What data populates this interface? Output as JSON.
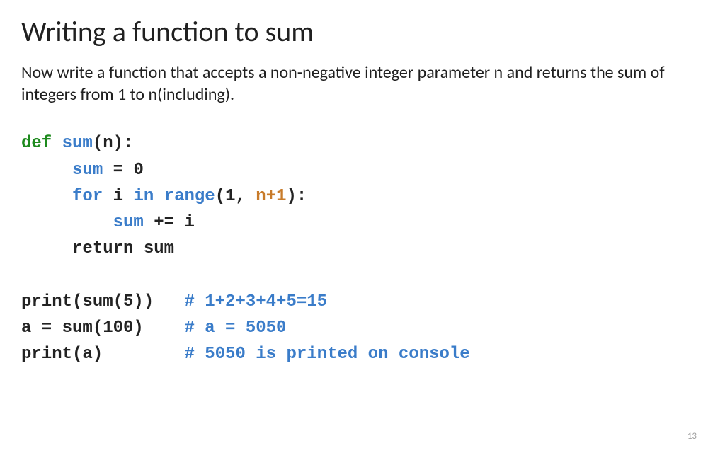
{
  "title": "Writing a function to sum",
  "description": "Now write a function that accepts a non-negative integer parameter n and returns the sum of integers from 1 to n(including).",
  "code": {
    "kw_def": "def",
    "fn_name": "sum",
    "paren_open_n": "(n):",
    "line2_var": "sum",
    "line2_rest": " = 0",
    "line3_for": "for",
    "line3_i": " i ",
    "line3_in": "in",
    "line3_range": " range",
    "line3_open": "(1, ",
    "line3_n1": "n+1",
    "line3_close": "):",
    "line4_var": "sum",
    "line4_rest": " += i",
    "line5": "return sum",
    "line6a": "print(sum(5))   ",
    "line6c": "# 1+2+3+4+5=15",
    "line7a": "a = sum(100)    ",
    "line7c": "# a = 5050",
    "line8a": "print(a)        ",
    "line8c": "# 5050 is printed on console"
  },
  "page_number": "13"
}
